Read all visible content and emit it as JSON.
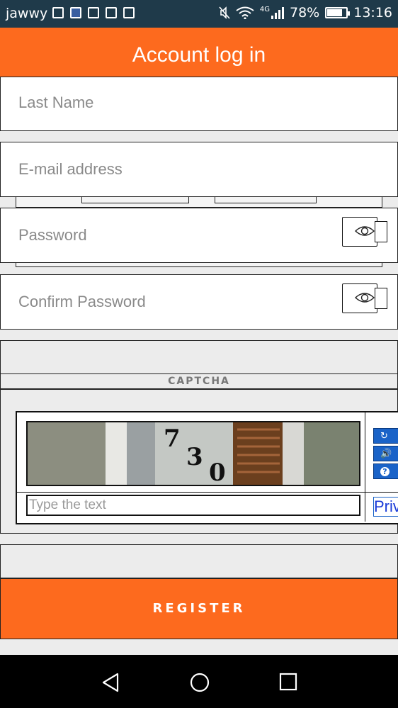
{
  "status_bar": {
    "carrier": "jawwy",
    "network": "4G",
    "battery": "78%",
    "battery_level": 0.78,
    "time": "13:16"
  },
  "header": {
    "title": "Account log in"
  },
  "form": {
    "last_name_placeholder": "Last Name",
    "email_placeholder": "E-mail address",
    "password_placeholder": "Password",
    "confirm_password_placeholder": "Confirm Password",
    "captcha_label": "CAPTCHA",
    "captcha_input_placeholder": "Type the text",
    "captcha_image_text": "730",
    "privacy_link": "Priv",
    "register_label": "REGISTER"
  },
  "icons": {
    "eye": "eye-icon",
    "refresh": "refresh-icon",
    "audio": "speaker-icon",
    "help": "help-icon",
    "back": "back-icon",
    "home": "home-icon",
    "recents": "recents-icon"
  },
  "colors": {
    "accent": "#fd6a1e",
    "statusbar": "#1f3a4a",
    "captcha_button": "#1a63c8"
  }
}
